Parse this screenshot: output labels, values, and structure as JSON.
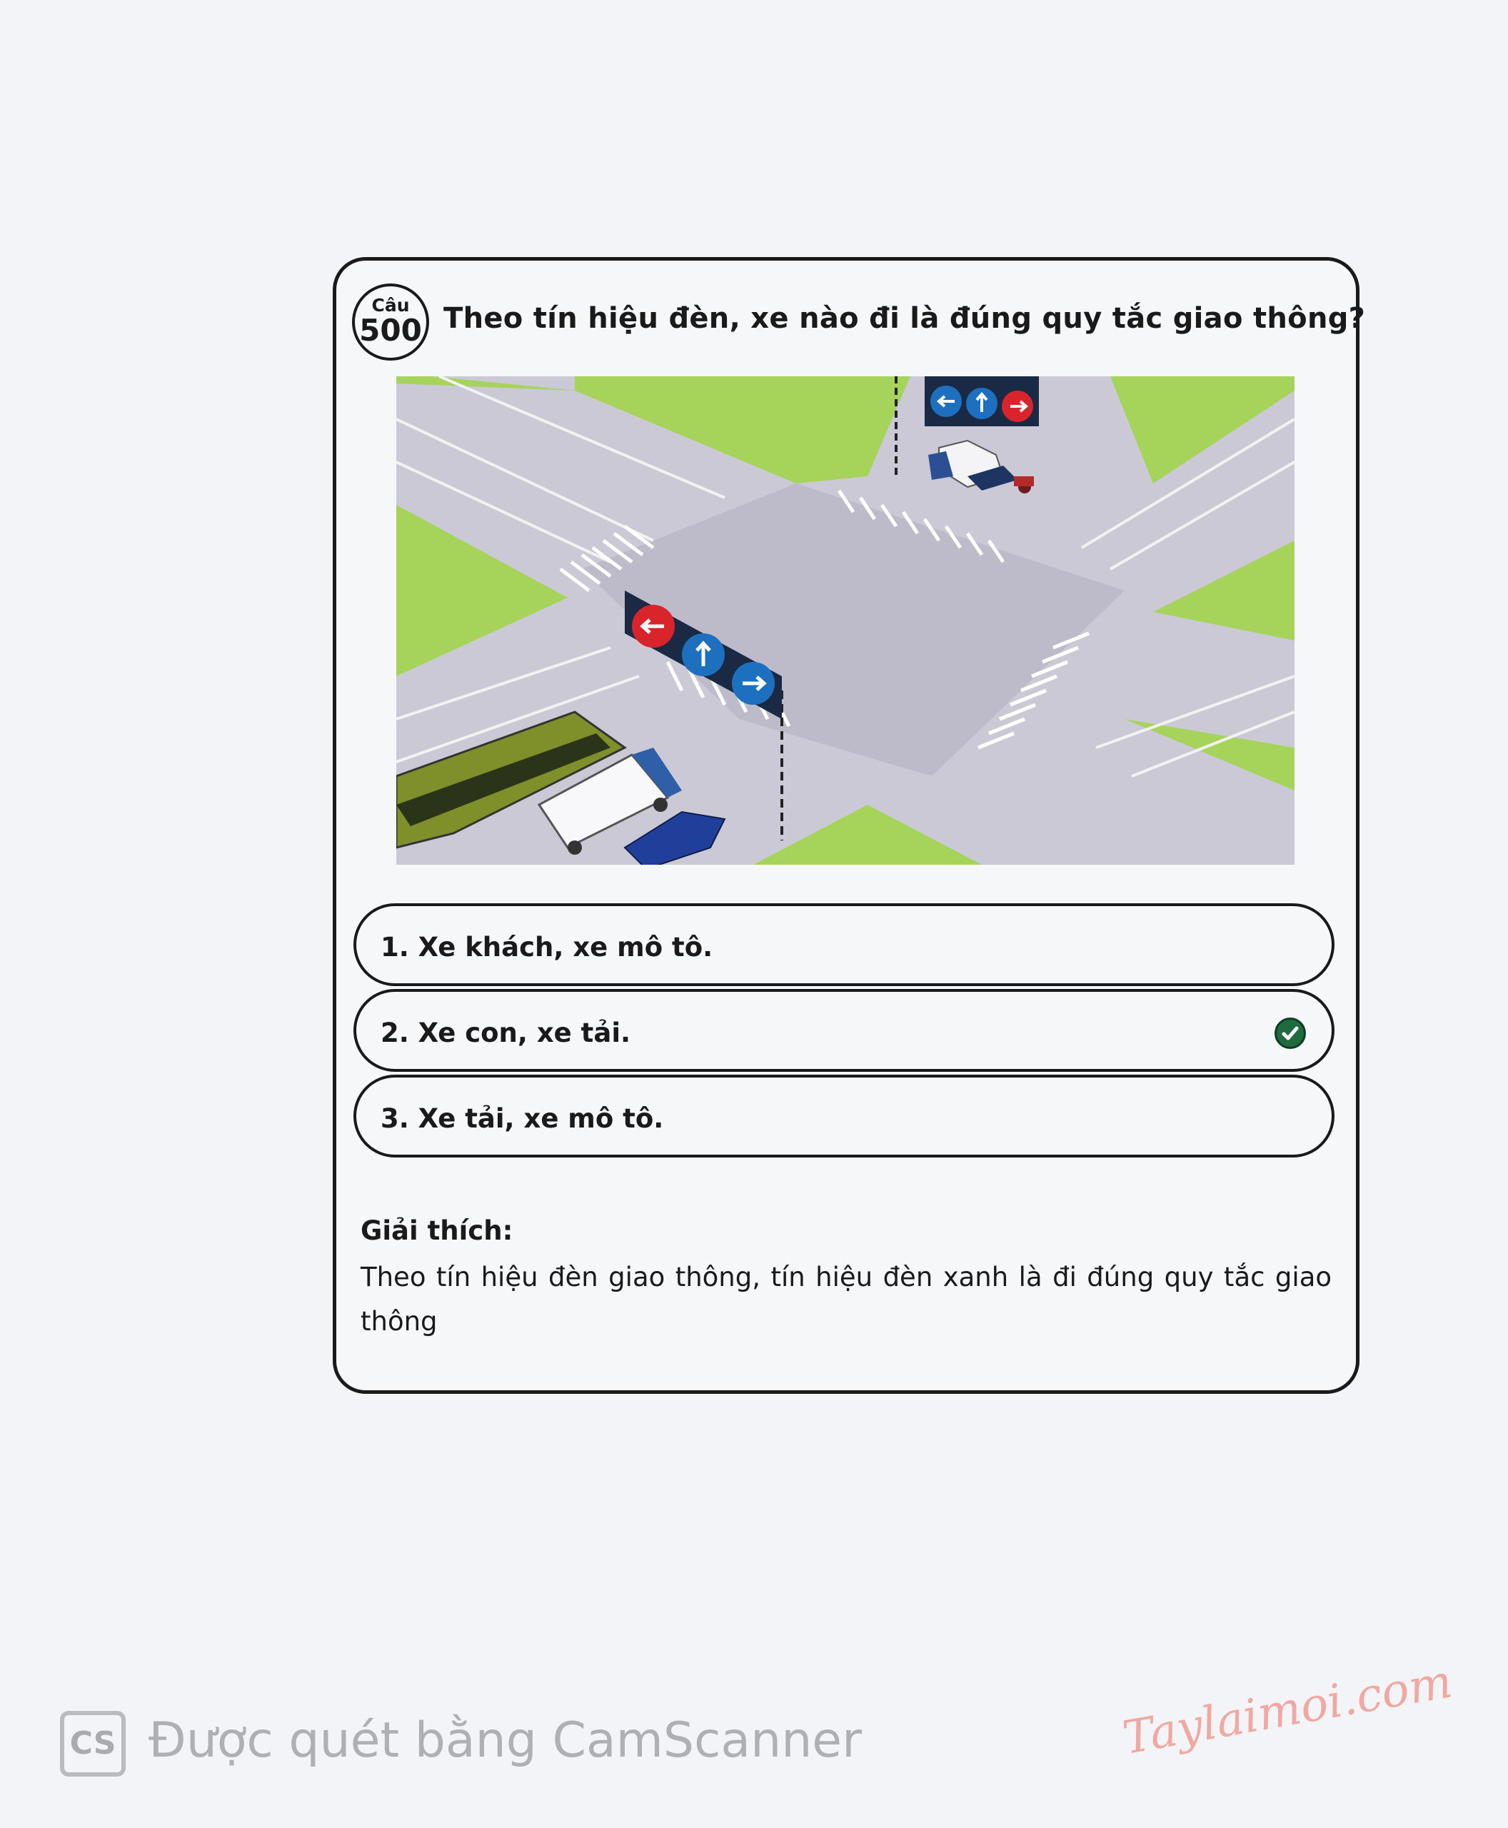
{
  "question": {
    "badge_top": "Câu",
    "badge_number": "500",
    "title": "Theo tín hiệu đèn, xe nào đi là đúng quy tắc giao thông?"
  },
  "answers": [
    {
      "label": "1. Xe khách, xe mô tô.",
      "correct": false
    },
    {
      "label": "2. Xe con, xe tải.",
      "correct": true
    },
    {
      "label": "3. Xe tải, xe mô tô.",
      "correct": false
    }
  ],
  "explanation": {
    "heading": "Giải thích:",
    "text": "Theo tín hiệu đèn giao thông, tín hiệu đèn xanh là đi đúng quy tắc giao thông"
  },
  "scanner": {
    "logo": "CS",
    "text": "Được quét bằng CamScanner"
  },
  "watermark": {
    "text": "Taylaimoi.com"
  },
  "colors": {
    "grass": "#9ccf4f",
    "road": "#c8c6d4",
    "signal_red": "#d8242a",
    "signal_blue": "#1d6fbf",
    "check_green": "#1f6b3f"
  }
}
